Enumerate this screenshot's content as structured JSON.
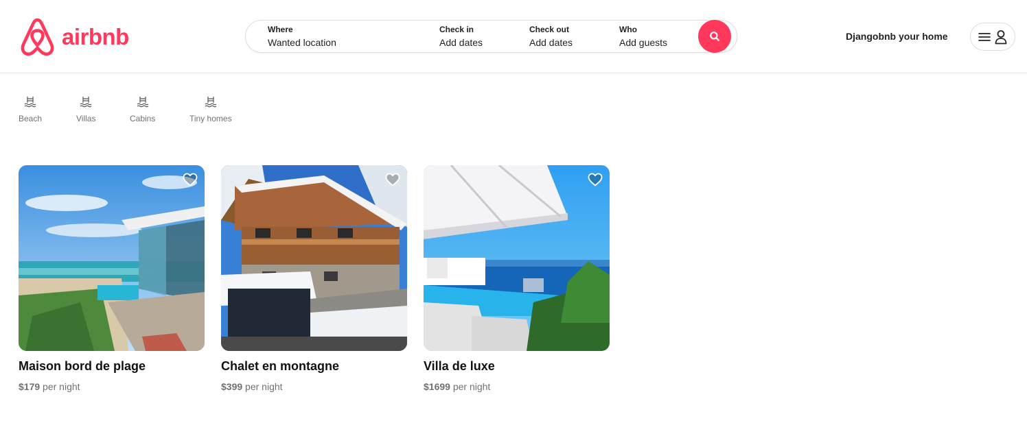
{
  "brand": {
    "name": "airbnb",
    "color": "#ff385c"
  },
  "search": {
    "where": {
      "label": "Where",
      "value": "Wanted location"
    },
    "check_in": {
      "label": "Check in",
      "value": "Add dates"
    },
    "check_out": {
      "label": "Check out",
      "value": "Add dates"
    },
    "who": {
      "label": "Who",
      "value": "Add guests"
    },
    "button_icon": "search-icon"
  },
  "header": {
    "host_link": "Djangobnb your home",
    "menu_icons": [
      "hamburger-icon",
      "user-icon"
    ]
  },
  "categories": [
    {
      "label": "Beach",
      "icon": "pool-icon"
    },
    {
      "label": "Villas",
      "icon": "pool-icon"
    },
    {
      "label": "Cabins",
      "icon": "pool-icon"
    },
    {
      "label": "Tiny homes",
      "icon": "pool-icon"
    }
  ],
  "listings": [
    {
      "title": "Maison bord de plage",
      "price": "$179",
      "unit": "per night",
      "icon": "heart-icon"
    },
    {
      "title": "Chalet en montagne",
      "price": "$399",
      "unit": "per night",
      "icon": "heart-icon"
    },
    {
      "title": "Villa de luxe",
      "price": "$1699",
      "unit": "per night",
      "icon": "heart-icon"
    }
  ]
}
